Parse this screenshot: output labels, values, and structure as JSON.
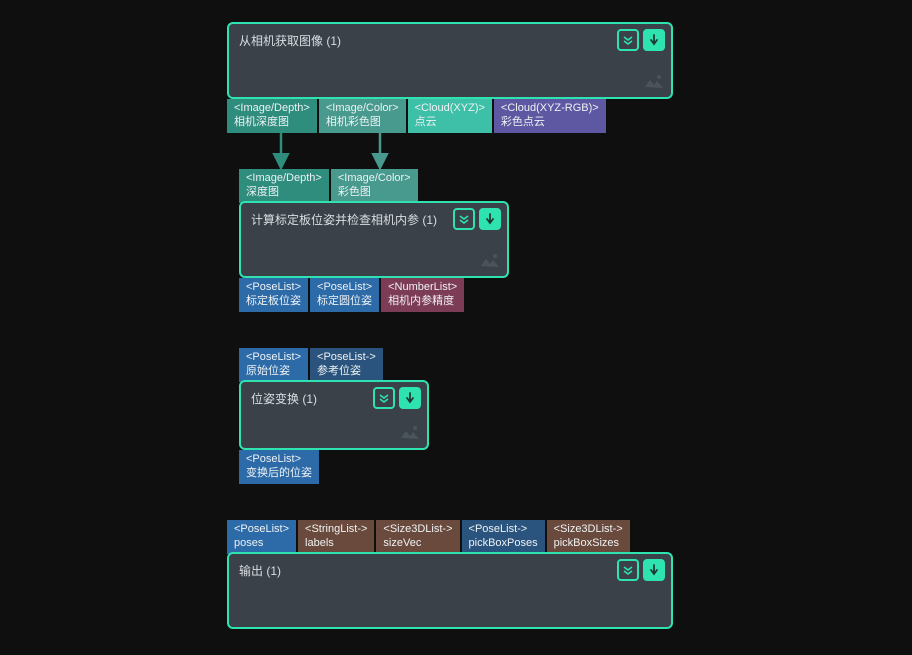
{
  "node1": {
    "title": "从相机获取图像 (1)",
    "outputs": [
      {
        "type": "<Image/Depth>",
        "label": "相机深度图"
      },
      {
        "type": "<Image/Color>",
        "label": "相机彩色图"
      },
      {
        "type": "<Cloud(XYZ)>",
        "label": "点云"
      },
      {
        "type": "<Cloud(XYZ-RGB)>",
        "label": "彩色点云"
      }
    ]
  },
  "node2": {
    "title": "计算标定板位姿并检查相机内参 (1)",
    "inputs": [
      {
        "type": "<Image/Depth>",
        "label": "深度图"
      },
      {
        "type": "<Image/Color>",
        "label": "彩色图"
      }
    ],
    "outputs": [
      {
        "type": "<PoseList>",
        "label": "标定板位姿"
      },
      {
        "type": "<PoseList>",
        "label": "标定圆位姿"
      },
      {
        "type": "<NumberList>",
        "label": "相机内参精度"
      }
    ]
  },
  "node3": {
    "title": "位姿变换 (1)",
    "inputs": [
      {
        "type": "<PoseList>",
        "label": "原始位姿"
      },
      {
        "type": "<PoseList->",
        "label": "参考位姿"
      }
    ],
    "outputs": [
      {
        "type": "<PoseList>",
        "label": "变换后的位姿"
      }
    ]
  },
  "node4": {
    "title": "输出 (1)",
    "inputs": [
      {
        "type": "<PoseList>",
        "label": "poses"
      },
      {
        "type": "<StringList->",
        "label": "labels"
      },
      {
        "type": "<Size3DList->",
        "label": "sizeVec"
      },
      {
        "type": "<PoseList->",
        "label": "pickBoxPoses"
      },
      {
        "type": "<Size3DList->",
        "label": "pickBoxSizes"
      }
    ]
  },
  "colors": {
    "accent": "#2fe3b0",
    "nodeBg": "#3a4149",
    "bg": "#0f0f0f"
  }
}
